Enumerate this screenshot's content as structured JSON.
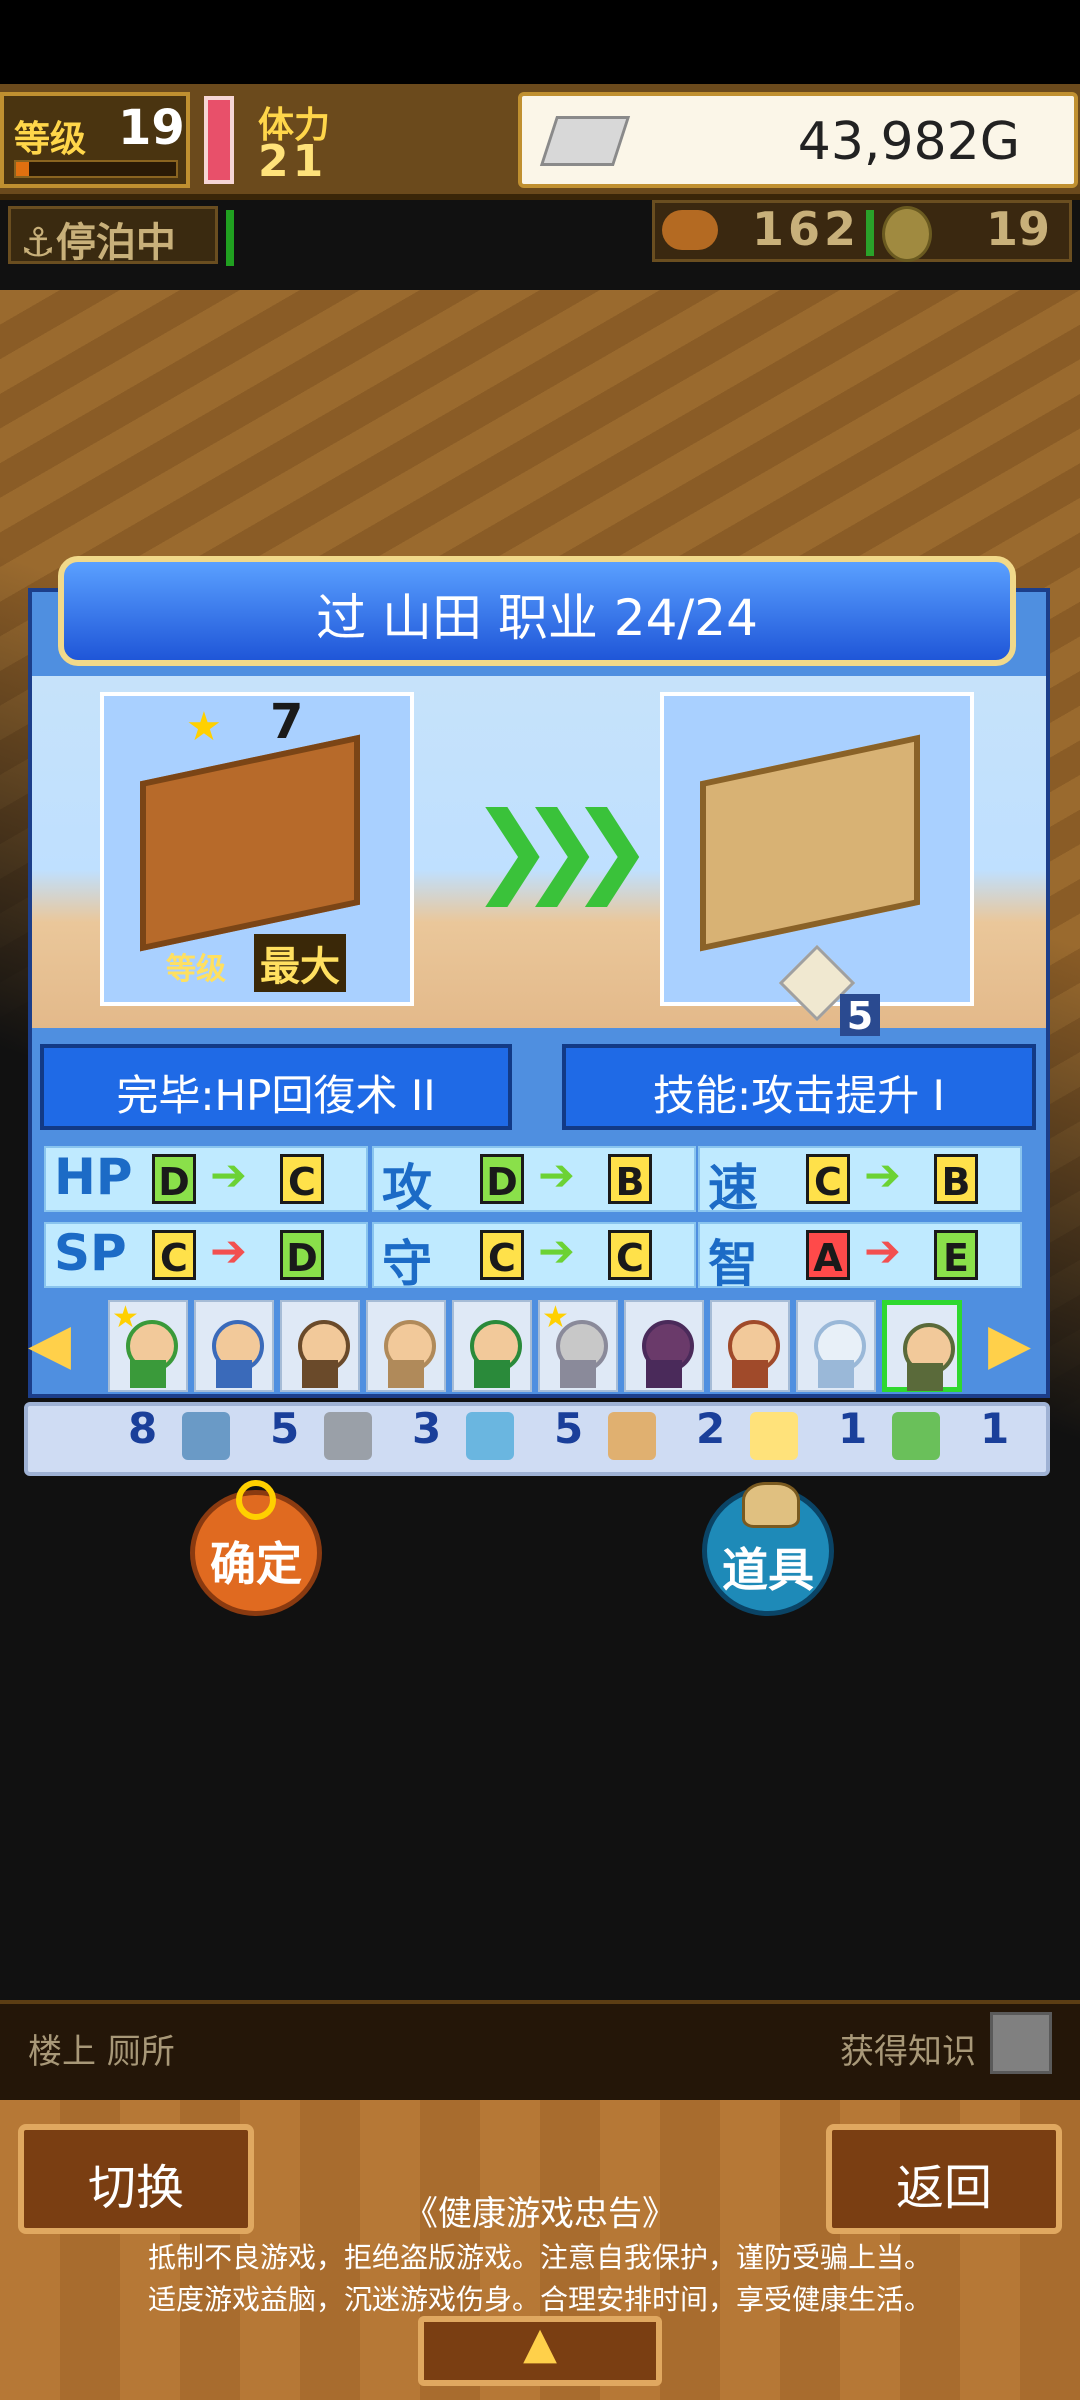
{
  "hud": {
    "level_label": "等级",
    "level_value": "19",
    "level_progress": 0.08,
    "stamina_label": "体力",
    "stamina_value": "21",
    "gold": "43,982G",
    "docked_status": "停泊中",
    "food_count": "162",
    "medal_count": "19"
  },
  "dialog": {
    "title": "过 山田  职业 24/24",
    "before": {
      "rank": "7",
      "level_label": "等级",
      "level_value": "最大"
    },
    "after": {
      "item_count": "5"
    },
    "complete_label": "完毕:HP回復术 II",
    "skill_label": "技能:攻击提升 I",
    "stats": [
      {
        "label": "HP",
        "from": "D",
        "to": "C",
        "direction": "up"
      },
      {
        "label": "攻",
        "from": "D",
        "to": "B",
        "direction": "up"
      },
      {
        "label": "速",
        "from": "C",
        "to": "B",
        "direction": "up"
      },
      {
        "label": "SP",
        "from": "C",
        "to": "D",
        "direction": "down"
      },
      {
        "label": "守",
        "from": "C",
        "to": "C",
        "direction": "up"
      },
      {
        "label": "智",
        "from": "A",
        "to": "E",
        "direction": "down"
      }
    ],
    "characters_count": 10,
    "selected_character_index": 9
  },
  "items": [
    {
      "count": "8",
      "icon": "spyglass-icon"
    },
    {
      "count": "5",
      "icon": "anchor-icon"
    },
    {
      "count": "3",
      "icon": "magnifier-icon"
    },
    {
      "count": "5",
      "icon": "fist-icon"
    },
    {
      "count": "2",
      "icon": "lightbulb-icon"
    },
    {
      "count": "1",
      "icon": "bandage-icon"
    },
    {
      "count": "1",
      "icon": ""
    }
  ],
  "actions": {
    "confirm_label": "确定",
    "items_label": "道具"
  },
  "bottom": {
    "location": "楼上 厕所",
    "acquire_knowledge": "获得知识",
    "switch_label": "切换",
    "back_label": "返回",
    "notice_title": "《健康游戏忠告》",
    "notice_line1": "抵制不良游戏，拒绝盗版游戏。注意自我保护，谨防受骗上当。",
    "notice_line2": "适度游戏益脑，沉迷游戏伤身。合理安排时间，享受健康生活。",
    "expand_icon": "▲"
  }
}
